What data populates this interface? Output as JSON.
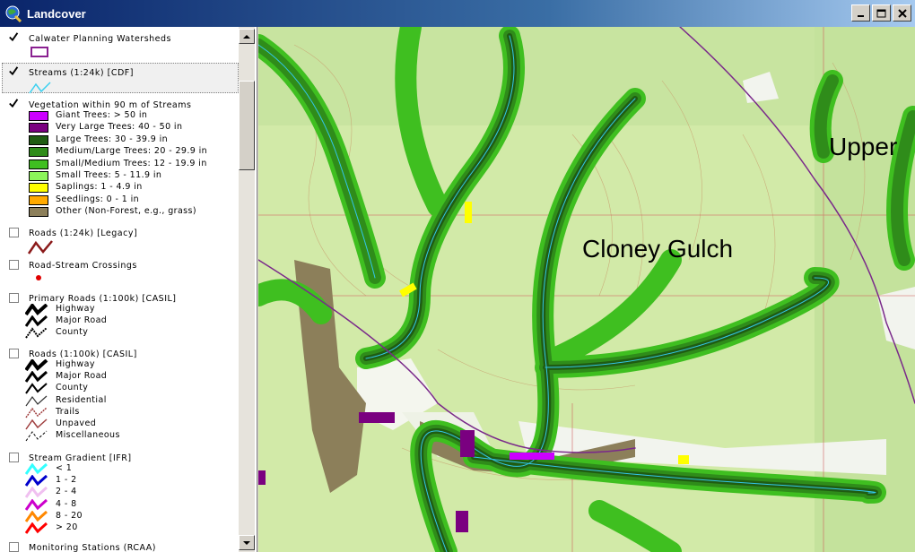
{
  "window": {
    "title": "Landcover"
  },
  "toc": {
    "layers": [
      {
        "name": "Calwater Planning Watersheds",
        "checked": true
      },
      {
        "name": "Streams (1:24k) [CDF]",
        "checked": true
      },
      {
        "name": "Vegetation within 90 m of Streams",
        "checked": true
      },
      {
        "name": "Roads (1:24k) [Legacy]",
        "checked": false
      },
      {
        "name": "Road-Stream Crossings",
        "checked": false
      },
      {
        "name": "Primary Roads (1:100k) [CASIL]",
        "checked": false
      },
      {
        "name": "Roads (1:100k) [CASIL]",
        "checked": false
      },
      {
        "name": "Stream Gradient [IFR]",
        "checked": false
      },
      {
        "name": "Monitoring Stations (RCAA)",
        "checked": false
      }
    ],
    "vegetation": [
      {
        "label": "Giant Trees: > 50 in",
        "color": "#cc00ff"
      },
      {
        "label": "Very Large Trees: 40 - 50 in",
        "color": "#7a0080"
      },
      {
        "label": "Large Trees: 30 - 39.9 in",
        "color": "#1f5c12"
      },
      {
        "label": "Medium/Large Trees: 20 - 29.9 in",
        "color": "#2f8c1a"
      },
      {
        "label": "Small/Medium Trees: 12 - 19.9 in",
        "color": "#3fbf20"
      },
      {
        "label": "Small Trees: 5 - 11.9 in",
        "color": "#8cf55a"
      },
      {
        "label": "Saplings: 1 - 4.9 in",
        "color": "#ffff00"
      },
      {
        "label": "Seedlings: 0 - 1 in",
        "color": "#ffaa00"
      },
      {
        "label": "Other (Non-Forest, e.g., grass)",
        "color": "#8c7f5a"
      }
    ],
    "primary_roads": [
      "Highway",
      "Major Road",
      "County"
    ],
    "roads_100k": [
      "Highway",
      "Major Road",
      "County",
      "Residential",
      "Trails",
      "Unpaved",
      "Miscellaneous"
    ],
    "stream_gradient": [
      {
        "label": "< 1",
        "color": "#33ffff"
      },
      {
        "label": "1 - 2",
        "color": "#0000cc"
      },
      {
        "label": "2 - 4",
        "color": "#f0c0f0"
      },
      {
        "label": "4 - 8",
        "color": "#cc00cc"
      },
      {
        "label": "8 - 20",
        "color": "#ff8800"
      },
      {
        "label": "> 20",
        "color": "#ff0000"
      }
    ]
  },
  "map": {
    "labels": {
      "cloney": "Cloney Gulch",
      "upper": "Upper"
    }
  }
}
